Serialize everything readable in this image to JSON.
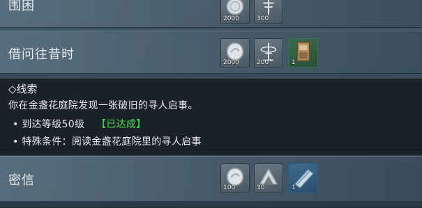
{
  "rows": [
    {
      "title": "围困",
      "rewards": [
        {
          "icon": "silver-coin-icon",
          "qty": "2000"
        },
        {
          "icon": "antenna-token-icon",
          "qty": "300"
        }
      ]
    },
    {
      "title": "借问往昔时",
      "rewards": [
        {
          "icon": "silver-coin-icon",
          "qty": "2000"
        },
        {
          "icon": "antenna-token-icon",
          "qty": "200"
        },
        {
          "icon": "book-item-icon",
          "qty": "1"
        }
      ]
    },
    {
      "title": "密信",
      "rewards": [
        {
          "icon": "silver-coin-icon",
          "qty": "100"
        },
        {
          "icon": "mountain-token-icon",
          "qty": "30"
        },
        {
          "icon": "scroll-item-icon",
          "qty": "1"
        }
      ]
    }
  ],
  "clue": {
    "heading": "◇线索",
    "description": "你在金盏花庭院发现一张破旧的寻人启事。",
    "conditions": [
      {
        "bullet": "•",
        "text": "到达等级50级",
        "status": "【已达成】"
      },
      {
        "bullet": "•",
        "text": "特殊条件：阅读金盏花庭院里的寻人启事",
        "status": ""
      }
    ]
  },
  "colors": {
    "achieved": "#43e24b",
    "panel": "#1b2129"
  }
}
